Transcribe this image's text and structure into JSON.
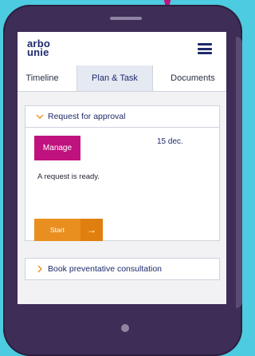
{
  "colors": {
    "background": "#4dcbe0",
    "device": "#3d2d57",
    "brand": "#1f2a6b",
    "accent_manage": "#c0127f",
    "accent_start": "#e98f1f",
    "chevron": "#e98f1f",
    "pointer": "#c0127f"
  },
  "header": {
    "logo_line1": "arbo",
    "logo_line2": "unie",
    "menu_icon": "hamburger-menu-icon"
  },
  "tabs": [
    {
      "label": "Timeline",
      "active": false
    },
    {
      "label": "Plan & Task",
      "active": true
    },
    {
      "label": "Documents",
      "active": false
    }
  ],
  "tasks": [
    {
      "title": "Request for approval",
      "expanded": true,
      "manage_label": "Manage",
      "date": "15 dec.",
      "description": "A request is ready.",
      "start_label": "Start",
      "start_icon": "→"
    },
    {
      "title": "Book preventative consultation",
      "expanded": false
    }
  ]
}
